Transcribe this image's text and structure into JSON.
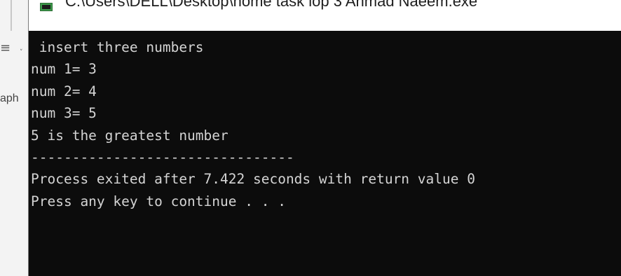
{
  "background_app": {
    "menu_icon": "hamburger-menu-icon",
    "chevron_icon": "chevron-down-icon",
    "truncated_text": "aph"
  },
  "window": {
    "title": "C:\\Users\\DELL\\Desktop\\home task lop 3 Ahmad Naeem.exe",
    "icon": "console-app-icon"
  },
  "console": {
    "lines": [
      " insert three numbers",
      "num 1= 3",
      "num 2= 4",
      "num 3= 5",
      "5 is the greatest number",
      "--------------------------------",
      "Process exited after 7.422 seconds with return value 0",
      "Press any key to continue . . ."
    ]
  },
  "colors": {
    "console_background": "#0c0c0c",
    "console_text": "#d4d4d4",
    "title_bar": "#ffffff"
  }
}
